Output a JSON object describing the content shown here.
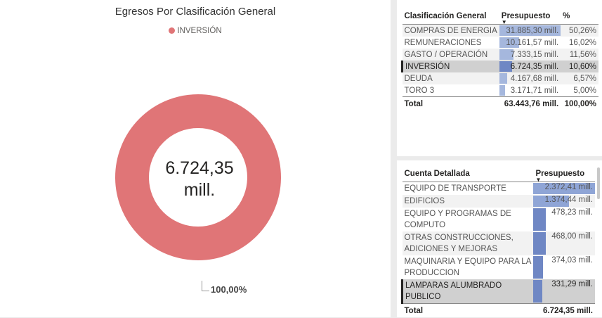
{
  "donut": {
    "title": "Egresos Por Clasificación General",
    "legend_label": "INVERSIÓN",
    "legend_color": "#e07577",
    "center_line1": "6.724,35",
    "center_line2": "mill.",
    "slice_label": "100,00%"
  },
  "table1": {
    "headers": {
      "name": "Clasificación General",
      "value": "Presupuesto",
      "pct": "%"
    },
    "rows": [
      {
        "name": "COMPRAS DE ENERGIA",
        "value": "31.885,30 mill.",
        "pct": "50,26%",
        "fraction": 1.0
      },
      {
        "name": "REMUNERACIONES",
        "value": "10.161,57 mill.",
        "pct": "16,02%",
        "fraction": 0.319
      },
      {
        "name": "GASTO / OPERACIÓN",
        "value": "7.333,15 mill.",
        "pct": "11,56%",
        "fraction": 0.23
      },
      {
        "name": "INVERSIÓN",
        "value": "6.724,35 mill.",
        "pct": "10,60%",
        "fraction": 0.211
      },
      {
        "name": "DEUDA",
        "value": "4.167,68 mill.",
        "pct": "6,57%",
        "fraction": 0.131
      },
      {
        "name": "TORO 3",
        "value": "3.171,71 mill.",
        "pct": "5,00%",
        "fraction": 0.099
      }
    ],
    "total": {
      "name": "Total",
      "value": "63.443,76 mill.",
      "pct": "100,00%"
    }
  },
  "table2": {
    "headers": {
      "name": "Cuenta Detallada",
      "value": "Presupuesto"
    },
    "rows": [
      {
        "name": "EQUIPO DE TRANSPORTE",
        "value": "2.372,41 mill.",
        "fraction": 1.0
      },
      {
        "name": "EDIFICIOS",
        "value": "1.374,44 mill.",
        "fraction": 0.579
      },
      {
        "name": "EQUIPO Y PROGRAMAS DE COMPUTO",
        "value": "478,23 mill.",
        "fraction": 0.202
      },
      {
        "name": "OTRAS CONSTRUCCIONES, ADICIONES Y MEJORAS",
        "value": "468,00 mill.",
        "fraction": 0.197
      },
      {
        "name": "MAQUINARIA Y EQUIPO PARA LA PRODUCCION",
        "value": "374,03 mill.",
        "fraction": 0.158
      },
      {
        "name": "LAMPARAS ALUMBRADO PUBLICO",
        "value": "331,29 mill.",
        "fraction": 0.14
      }
    ],
    "total": {
      "name": "Total",
      "value": "6.724,35 mill."
    }
  }
}
